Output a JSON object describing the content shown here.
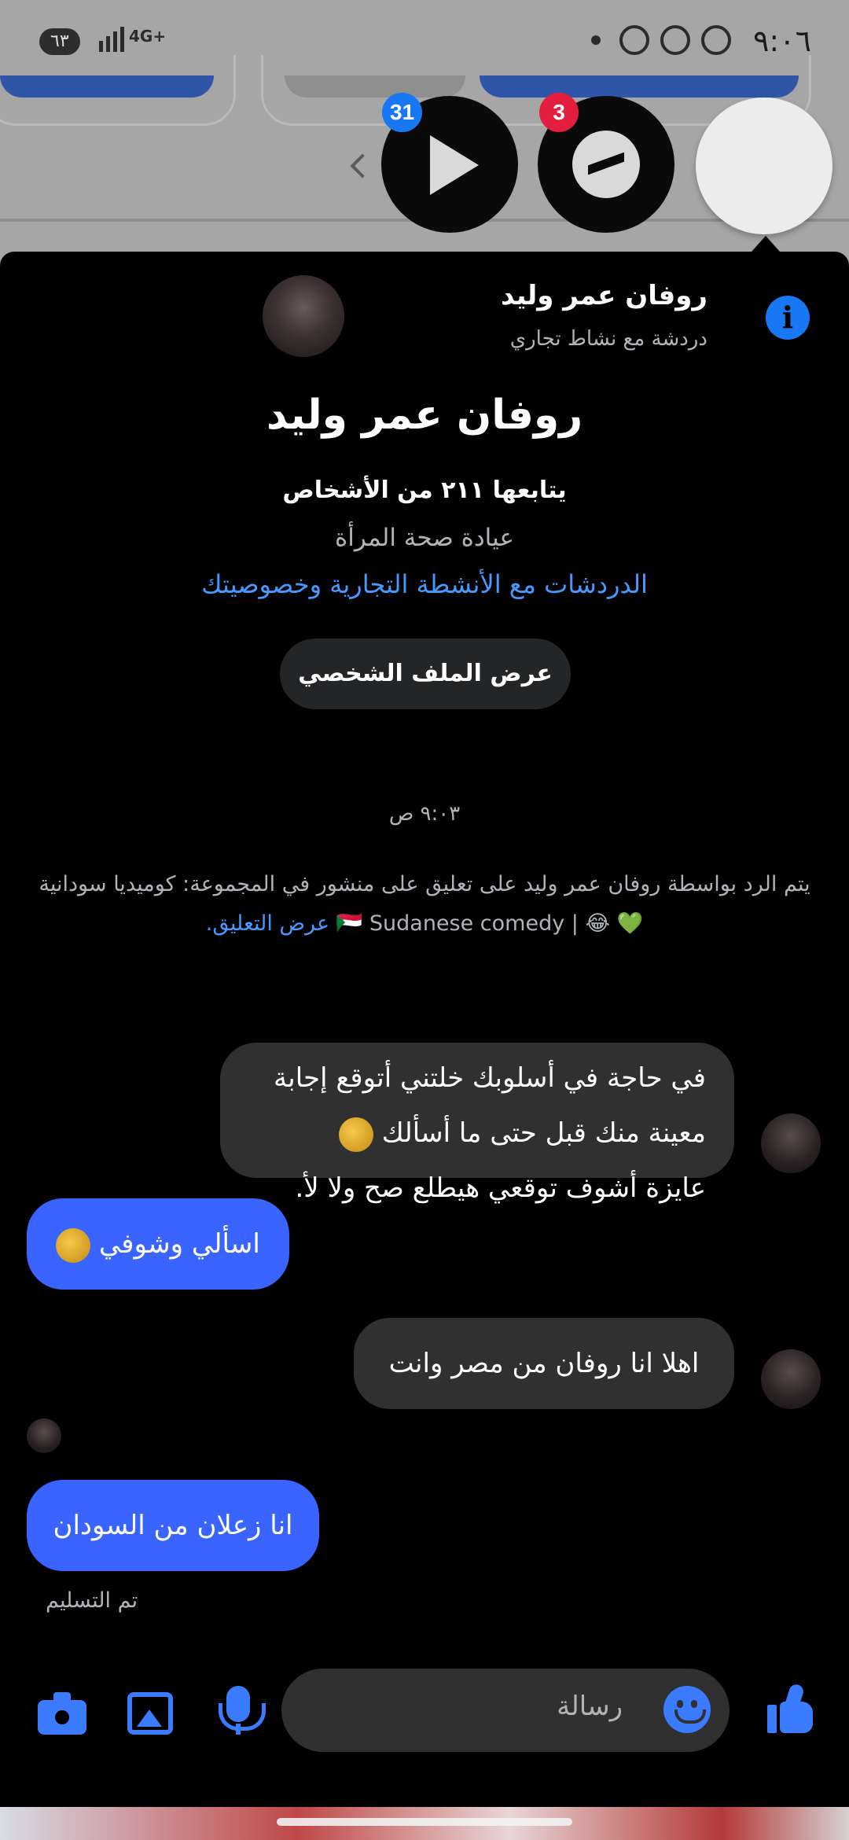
{
  "status_bar": {
    "time": "٩:٠٦",
    "battery": "٦٣",
    "network": "4G+"
  },
  "chat_heads": {
    "video_badge": "31",
    "messenger_badge": "3"
  },
  "header": {
    "name": "روفان عمر وليد",
    "subtitle": "دردشة مع نشاط تجاري",
    "info_icon": "info-icon"
  },
  "profile": {
    "name": "روفان عمر وليد",
    "followers": "يتابعها ٢١١ من الأشخاص",
    "category": "عيادة صحة المرأة",
    "privacy_link": "الدردشات مع الأنشطة التجارية وخصوصيتك",
    "view_profile_button": "عرض الملف الشخصي"
  },
  "timestamp": "٩:٠٣ ص",
  "notice": {
    "text": "يتم الرد بواسطة روفان عمر وليد على تعليق على منشور في المجموعة: كوميديا سودانية 💚 😂 | 🇸🇩 Sudanese comedy",
    "link": "عرض التعليق."
  },
  "messages": [
    {
      "from": "them",
      "lines": [
        "في حاجة في أسلوبك خلتني أتوقع إجابة",
        "معينة منك قبل حتى ما أسألك",
        "عايزة أشوف توقعي هيطلع صح ولا لأ."
      ]
    },
    {
      "from": "me",
      "text": "اسألي وشوفي"
    },
    {
      "from": "them",
      "text": "اهلا انا  روفان من مصر وانت"
    },
    {
      "from": "me",
      "text": "انا زعلان من السودان"
    }
  ],
  "delivered_status": "تم التسليم",
  "composer": {
    "placeholder": "رسالة"
  },
  "colors": {
    "accent": "#3a64ff",
    "link": "#4599ff",
    "panel_bg": "#000000",
    "incoming_bubble": "#303030",
    "badge_blue": "#1877f2",
    "badge_red": "#e41e3f"
  }
}
